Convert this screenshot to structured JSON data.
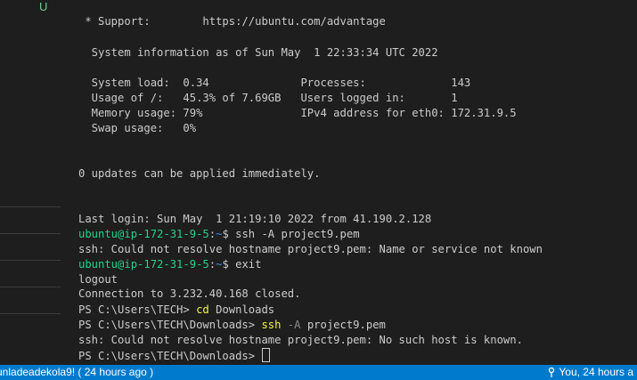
{
  "sidebar": {
    "badge": "U"
  },
  "terminal": {
    "support": " * Support:        https://ubuntu.com/advantage",
    "sysinfo": "  System information as of Sun May  1 22:33:34 UTC 2022",
    "stats": [
      "  System load:  0.34              Processes:             143",
      "  Usage of /:   45.3% of 7.69GB   Users logged in:       1",
      "  Memory usage: 79%               IPv4 address for eth0: 172.31.9.5",
      "  Swap usage:   0%"
    ],
    "updates": "0 updates can be applied immediately.",
    "last_login": "Last login: Sun May  1 21:19:10 2022 from 41.190.2.128",
    "prompt_user": "ubuntu@ip-172-31-9-5",
    "prompt_colon": ":",
    "prompt_path": "~",
    "prompt_dollar": "$ ",
    "cmd1": "ssh -A project9.pem",
    "err1": "ssh: Could not resolve hostname project9.pem: Name or service not known",
    "cmd2": "exit",
    "logout": "logout",
    "closed": "Connection to 3.232.40.168 closed.",
    "ps1": "PS C:\\Users\\TECH> ",
    "ps1_cmd": "cd",
    "ps1_arg": " Downloads",
    "ps2": "PS C:\\Users\\TECH\\Downloads> ",
    "ps2_cmd": "ssh",
    "ps2_flag": " -A",
    "ps2_arg": " project9.pem",
    "err2": "ssh: Could not resolve hostname project9.pem: No such host is known.",
    "ps3": "PS C:\\Users\\TECH\\Downloads> "
  },
  "statusbar": {
    "left_text": "unladeadekola9! ( 24 hours ago )",
    "right_text": "You, 24 hours a"
  },
  "colors": {
    "prompt_user": "#23d18b",
    "prompt_path": "#3b8eea",
    "command": "#f5f543",
    "statusbar": "#007acc",
    "background": "#1e1e1e"
  }
}
